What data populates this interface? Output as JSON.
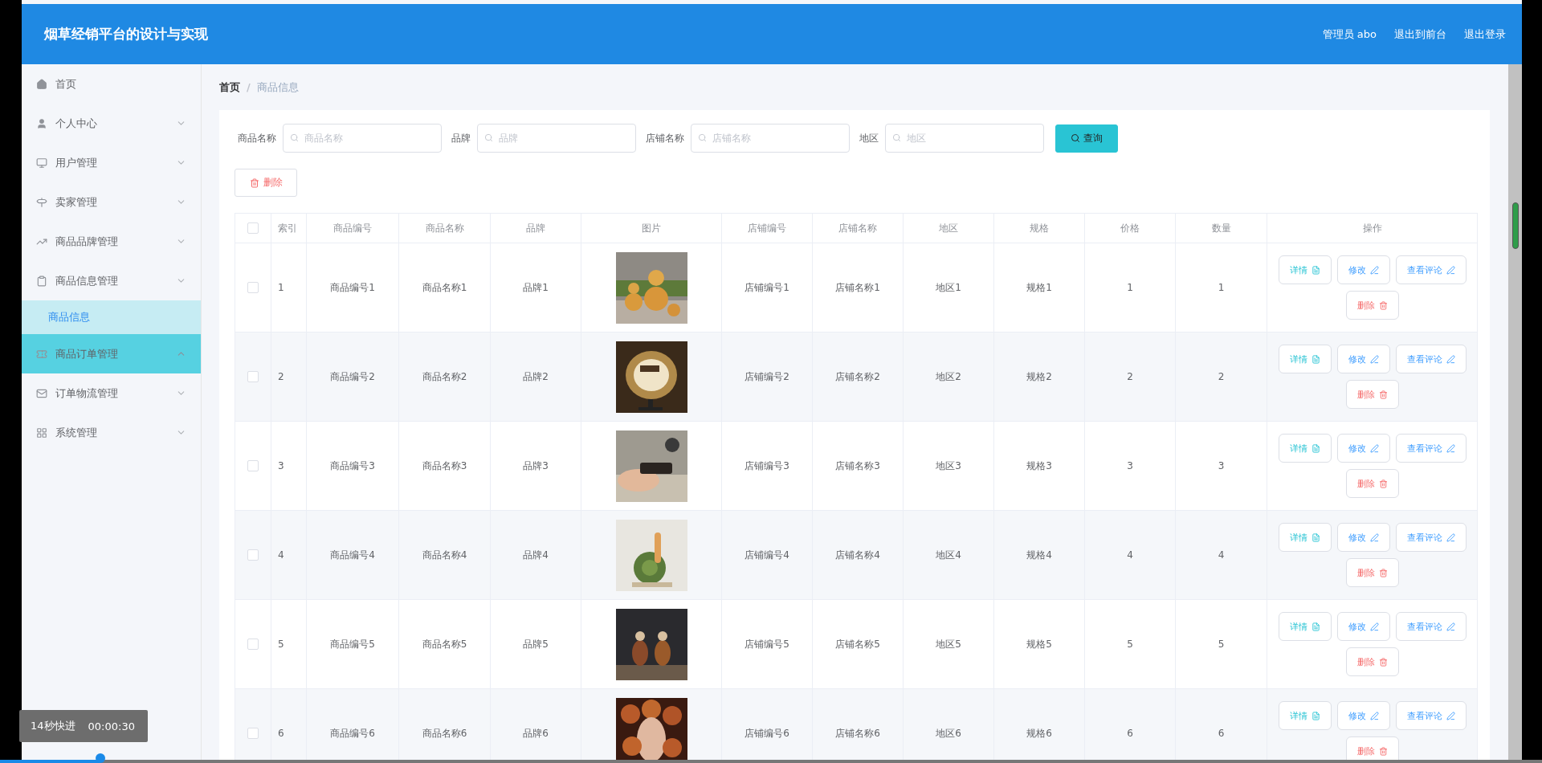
{
  "header": {
    "title": "烟草经销平台的设计与实现",
    "links": [
      "管理员 abo",
      "退出到前台",
      "退出登录"
    ]
  },
  "sidebar": {
    "items": [
      {
        "label": "首页",
        "hovered": false
      },
      {
        "label": "个人中心",
        "expanded": false,
        "hovered": false
      },
      {
        "label": "用户管理",
        "expanded": false,
        "hovered": false
      },
      {
        "label": "卖家管理",
        "expanded": false,
        "hovered": false
      },
      {
        "label": "商品品牌管理",
        "expanded": false,
        "hovered": false
      },
      {
        "label": "商品信息管理",
        "expanded": false,
        "hovered": false,
        "children": [
          {
            "label": "商品信息",
            "selected": true
          }
        ]
      },
      {
        "label": "商品订单管理",
        "expanded": true,
        "hovered": true
      },
      {
        "label": "订单物流管理",
        "expanded": false,
        "hovered": false
      },
      {
        "label": "系统管理",
        "expanded": false,
        "hovered": false
      }
    ]
  },
  "breadcrumb": {
    "items": [
      "首页",
      "商品信息"
    ],
    "separator": "/"
  },
  "filters": [
    {
      "label": "商品名称",
      "placeholder": "商品名称"
    },
    {
      "label": "品牌",
      "placeholder": "品牌"
    },
    {
      "label": "店铺名称",
      "placeholder": "店铺名称"
    },
    {
      "label": "地区",
      "placeholder": "地区"
    }
  ],
  "search_button": "查询",
  "delete_button": "删除",
  "table": {
    "all_selected": false,
    "columns": [
      "索引",
      "商品编号",
      "商品名称",
      "品牌",
      "图片",
      "店铺编号",
      "店铺名称",
      "地区",
      "规格",
      "价格",
      "数量",
      "操作"
    ],
    "rows": [
      {
        "selected": false,
        "cells": [
          "1",
          "商品编号1",
          "商品名称1",
          "品牌1",
          "",
          "店铺编号1",
          "店铺名称1",
          "地区1",
          "规格1",
          "1",
          "1"
        ],
        "actions": [
          {
            "kind": "detail",
            "label": "详情"
          },
          {
            "kind": "edit",
            "label": "修改"
          },
          {
            "kind": "comment",
            "label": "查看评论"
          },
          {
            "kind": "delete",
            "label": "删除"
          }
        ]
      },
      {
        "selected": false,
        "cells": [
          "2",
          "商品编号2",
          "商品名称2",
          "品牌2",
          "",
          "店铺编号2",
          "店铺名称2",
          "地区2",
          "规格2",
          "2",
          "2"
        ],
        "actions": [
          {
            "kind": "detail",
            "label": "详情"
          },
          {
            "kind": "edit",
            "label": "修改"
          },
          {
            "kind": "comment",
            "label": "查看评论"
          },
          {
            "kind": "delete",
            "label": "删除"
          }
        ]
      },
      {
        "selected": false,
        "cells": [
          "3",
          "商品编号3",
          "商品名称3",
          "品牌3",
          "",
          "店铺编号3",
          "店铺名称3",
          "地区3",
          "规格3",
          "3",
          "3"
        ],
        "actions": [
          {
            "kind": "detail",
            "label": "详情"
          },
          {
            "kind": "edit",
            "label": "修改"
          },
          {
            "kind": "comment",
            "label": "查看评论"
          },
          {
            "kind": "delete",
            "label": "删除"
          }
        ]
      },
      {
        "selected": false,
        "cells": [
          "4",
          "商品编号4",
          "商品名称4",
          "品牌4",
          "",
          "店铺编号4",
          "店铺名称4",
          "地区4",
          "规格4",
          "4",
          "4"
        ],
        "actions": [
          {
            "kind": "detail",
            "label": "详情"
          },
          {
            "kind": "edit",
            "label": "修改"
          },
          {
            "kind": "comment",
            "label": "查看评论"
          },
          {
            "kind": "delete",
            "label": "删除"
          }
        ]
      },
      {
        "selected": false,
        "cells": [
          "5",
          "商品编号5",
          "商品名称5",
          "品牌5",
          "",
          "店铺编号5",
          "店铺名称5",
          "地区5",
          "规格5",
          "5",
          "5"
        ],
        "actions": [
          {
            "kind": "detail",
            "label": "详情"
          },
          {
            "kind": "edit",
            "label": "修改"
          },
          {
            "kind": "comment",
            "label": "查看评论"
          },
          {
            "kind": "delete",
            "label": "删除"
          }
        ]
      },
      {
        "selected": false,
        "cells": [
          "6",
          "商品编号6",
          "商品名称6",
          "品牌6",
          "",
          "店铺编号6",
          "店铺名称6",
          "地区6",
          "规格6",
          "6",
          "6"
        ],
        "actions": [
          {
            "kind": "detail",
            "label": "详情"
          },
          {
            "kind": "edit",
            "label": "修改"
          },
          {
            "kind": "comment",
            "label": "查看评论"
          },
          {
            "kind": "delete",
            "label": "删除"
          }
        ]
      }
    ]
  },
  "video_overlay": {
    "label": "14秒快进",
    "time": "00:00:30",
    "level": 0.065
  }
}
